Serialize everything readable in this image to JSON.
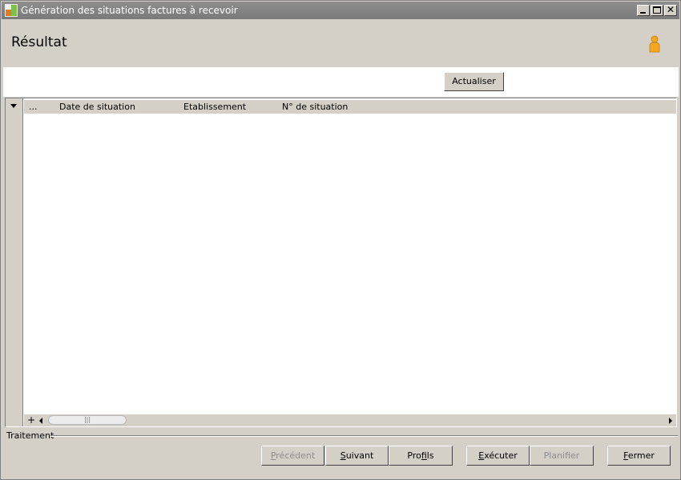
{
  "window": {
    "title": "Génération des situations factures à recevoir"
  },
  "header": {
    "title": "Résultat"
  },
  "toolbar": {
    "refresh_label": "Actualiser"
  },
  "grid": {
    "columns": [
      "...",
      "Date de situation",
      "Etablissement",
      "N° de situation"
    ],
    "rows": [],
    "add_symbol": "+",
    "scroll_thumb_grip": "|||"
  },
  "section": {
    "label": "Traitement"
  },
  "buttons": {
    "previous": {
      "label": "Précédent",
      "mnemonic": "P",
      "rest": "récédent",
      "enabled": false
    },
    "next": {
      "label": "Suivant",
      "mnemonic": "S",
      "rest": "uivant",
      "enabled": true
    },
    "profiles": {
      "label": "Profils",
      "pre": "Pro",
      "mnemonic": "f",
      "rest": "ils",
      "enabled": true
    },
    "execute": {
      "label": "Exécuter",
      "mnemonic": "E",
      "rest": "xécuter",
      "enabled": true
    },
    "plan": {
      "label": "Planifier",
      "mnemonic": "",
      "rest": "Planifier",
      "enabled": false
    },
    "close": {
      "label": "Fermer",
      "mnemonic": "F",
      "rest": "ermer",
      "enabled": true
    }
  },
  "icons": {
    "app": "app-icon",
    "user": "user-icon",
    "dropdown": "chevron-down-icon"
  },
  "colors": {
    "titlebar": "#7f7f7f",
    "window_bg": "#d4d0c8",
    "user_icon": "#f5a623",
    "app_icon_left": "#e07b22",
    "app_icon_right": "#7ec04a"
  }
}
